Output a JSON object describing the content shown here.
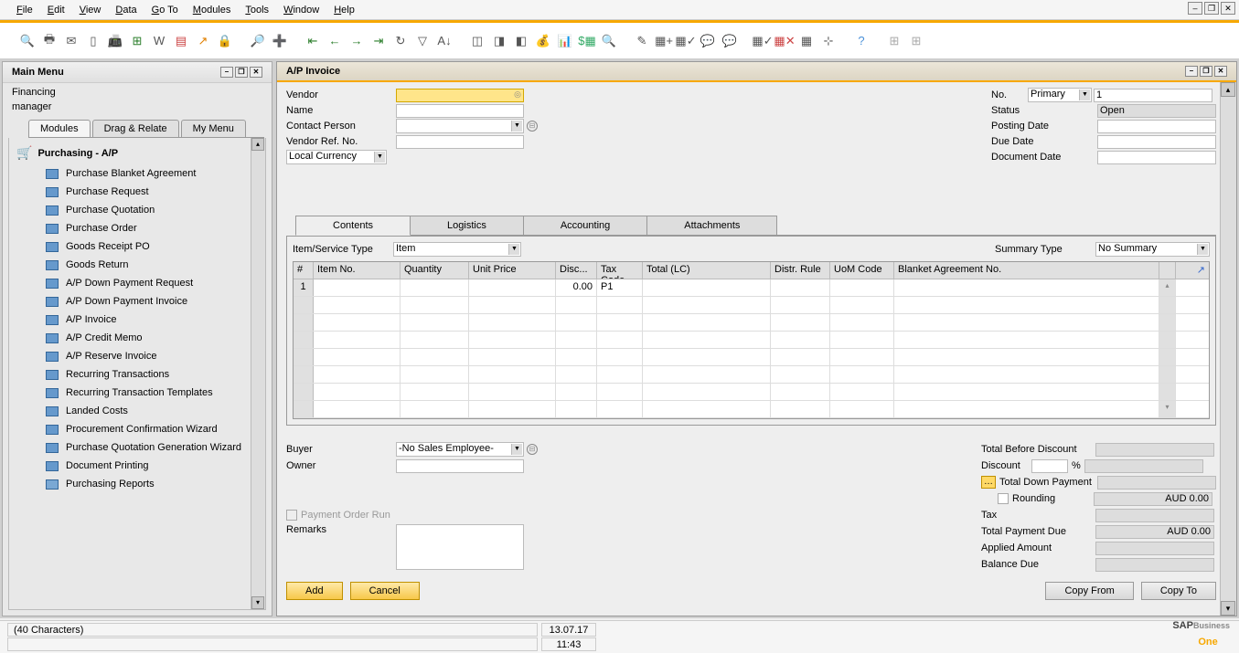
{
  "menu": {
    "file": "File",
    "edit": "Edit",
    "view": "View",
    "data": "Data",
    "goto": "Go To",
    "modules": "Modules",
    "tools": "Tools",
    "window": "Window",
    "help": "Help"
  },
  "mainMenu": {
    "title": "Main Menu",
    "line1": "Financing",
    "line2": "manager",
    "tabs": [
      "Modules",
      "Drag & Relate",
      "My Menu"
    ],
    "parent": "Purchasing - A/P",
    "items": [
      "Purchase Blanket Agreement",
      "Purchase Request",
      "Purchase Quotation",
      "Purchase Order",
      "Goods Receipt PO",
      "Goods Return",
      "A/P Down Payment Request",
      "A/P Down Payment Invoice",
      "A/P Invoice",
      "A/P Credit Memo",
      "A/P Reserve Invoice",
      "Recurring Transactions",
      "Recurring Transaction Templates",
      "Landed Costs",
      "Procurement Confirmation Wizard",
      "Purchase Quotation Generation Wizard",
      "Document Printing"
    ],
    "folderItem": "Purchasing Reports"
  },
  "invoice": {
    "title": "A/P Invoice",
    "labels": {
      "vendor": "Vendor",
      "name": "Name",
      "contact": "Contact Person",
      "vendorRef": "Vendor Ref. No.",
      "currency": "Local Currency",
      "no": "No.",
      "primary": "Primary",
      "noVal": "1",
      "status": "Status",
      "statusVal": "Open",
      "postingDate": "Posting Date",
      "dueDate": "Due Date",
      "docDate": "Document Date"
    },
    "tabs": [
      "Contents",
      "Logistics",
      "Accounting",
      "Attachments"
    ],
    "itemService": "Item/Service Type",
    "itemServiceVal": "Item",
    "summaryType": "Summary Type",
    "summaryTypeVal": "No Summary",
    "gridHeaders": [
      "#",
      "Item No.",
      "Quantity",
      "Unit Price",
      "Disc...",
      "Tax Code",
      "Total (LC)",
      "Distr. Rule",
      "UoM Code",
      "Blanket Agreement No."
    ],
    "row1": {
      "num": "1",
      "disc": "0.00",
      "tax": "P1"
    },
    "buyer": "Buyer",
    "buyerVal": "-No Sales Employee-",
    "owner": "Owner",
    "payOrder": "Payment Order Run",
    "remarks": "Remarks",
    "totals": {
      "before": "Total Before Discount",
      "discount": "Discount",
      "pct": "%",
      "downPay": "Total Down Payment",
      "rounding": "Rounding",
      "roundingVal": "AUD 0.00",
      "tax": "Tax",
      "totalDue": "Total Payment Due",
      "totalDueVal": "AUD 0.00",
      "applied": "Applied Amount",
      "balance": "Balance Due"
    },
    "buttons": {
      "add": "Add",
      "cancel": "Cancel",
      "copyFrom": "Copy From",
      "copyTo": "Copy To"
    }
  },
  "status": {
    "chars": "(40 Characters)",
    "date": "13.07.17",
    "time": "11:43"
  }
}
